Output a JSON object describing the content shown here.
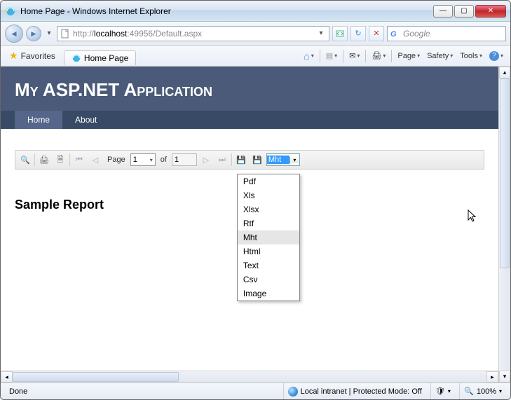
{
  "window": {
    "title": "Home Page - Windows Internet Explorer"
  },
  "nav": {
    "url_prefix": "http://",
    "url_host": "localhost",
    "url_port_path": ":49956/Default.aspx",
    "search_placeholder": "Google"
  },
  "favbar": {
    "favorites_label": "Favorites",
    "tab_label": "Home Page",
    "menu": {
      "page": "Page",
      "safety": "Safety",
      "tools": "Tools"
    }
  },
  "asp": {
    "heading": "My ASP.NET Application",
    "nav": {
      "home": "Home",
      "about": "About"
    }
  },
  "report": {
    "toolbar": {
      "page_label": "Page",
      "current_page": "1",
      "of_label": "of",
      "total_pages": "1",
      "export_selected": "Mht"
    },
    "export_options": [
      "Pdf",
      "Xls",
      "Xlsx",
      "Rtf",
      "Mht",
      "Html",
      "Text",
      "Csv",
      "Image"
    ],
    "title": "Sample Report"
  },
  "status": {
    "left": "Done",
    "zone": "Local intranet | Protected Mode: Off",
    "zoom": "100%"
  },
  "icons": {
    "back": "◄",
    "forward": "►",
    "refresh": "↻",
    "stop": "✕",
    "dropdown": "▾",
    "min": "—",
    "max": "▢",
    "close": "✕",
    "first": "⏮",
    "prev": "◁",
    "next": "▷",
    "last": "⏭",
    "save": "💾",
    "print": "🖨",
    "search": "🔍",
    "star": "★",
    "home": "⌂",
    "rss": "▤",
    "mail": "✉",
    "printer": "🖨",
    "help": "?",
    "gear": "⚙"
  }
}
